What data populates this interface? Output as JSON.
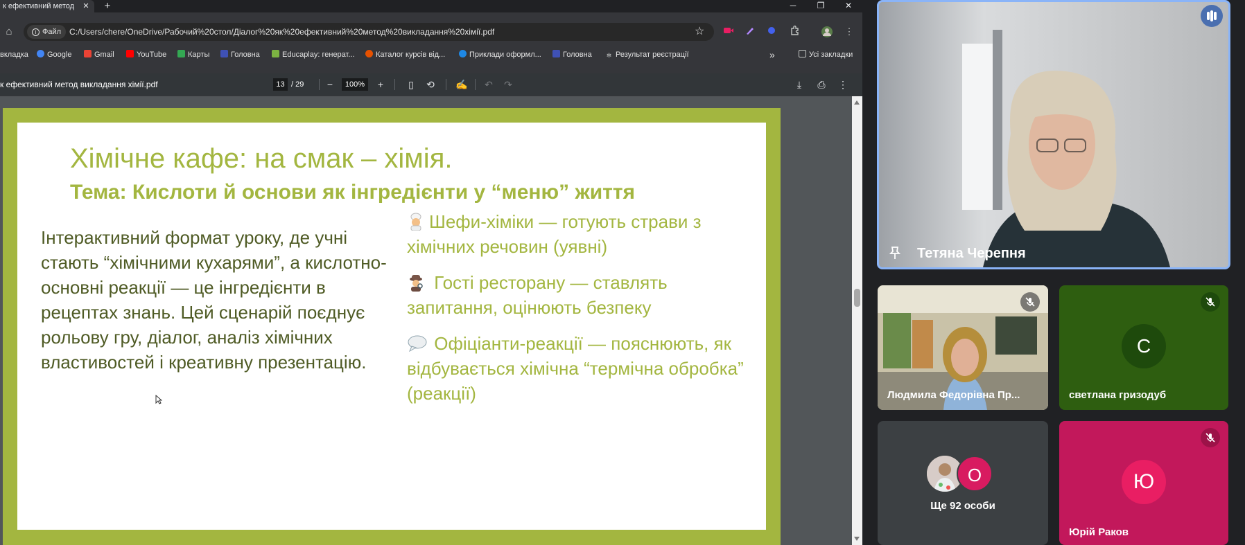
{
  "browser": {
    "tab_title": "к ефективний метод в",
    "tab_close": "✕",
    "new_tab": "+",
    "window": {
      "minimize": "─",
      "restore": "❐",
      "close": "✕"
    },
    "site_chip": "Файл",
    "url": "C:/Users/chere/OneDrive/Рабочий%20стол/Діалог%20як%20ефективний%20метод%20викладання%20хімії.pdf",
    "bookmarks": [
      {
        "label": "вкладка",
        "color": ""
      },
      {
        "label": "Google",
        "color": "#4285f4"
      },
      {
        "label": "Gmail",
        "color": "#ea4335"
      },
      {
        "label": "YouTube",
        "color": "#ff0000"
      },
      {
        "label": "Карты",
        "color": "#34a853"
      },
      {
        "label": "Головна",
        "color": "#3f51b5"
      },
      {
        "label": "Educaplay: генерат...",
        "color": "#7cb342"
      },
      {
        "label": "Каталог курсів від...",
        "color": "#e65100"
      },
      {
        "label": "Приклади оформл...",
        "color": "#1e88e5"
      },
      {
        "label": "Головна",
        "color": "#3f51b5"
      },
      {
        "label": "Результат реєстрації",
        "color": ""
      }
    ],
    "bookmarks_more": "»",
    "all_bookmarks": "Усі закладки"
  },
  "pdf": {
    "file_title": "к ефективний метод викладання хімії.pdf",
    "page": "13",
    "total_pages": "/  29",
    "zoom": "100%"
  },
  "slide": {
    "title": "Хімічне кафе: на смак – хімія.",
    "subtitle": "Тема: Кислоти й основи як інгредієнти у “меню” життя",
    "left_text": " Інтерактивний формат уроку, де учні стають “хімічними кухарями”, а кислотно-основні реакції — це інгредієнти в рецептах знань. Цей сценарій поєднує рольову гру, діалог, аналіз хімічних властивостей і креативну презентацію.",
    "right_items": [
      {
        "icon": "chef-emoji",
        "text": "Шефи-хіміки — готують страви з хімічних речовин (уявні)"
      },
      {
        "icon": "detective-emoji",
        "text": " Гості ресторану — ставлять запитання, оцінюють безпеку"
      },
      {
        "icon": "speech-bubble-emoji",
        "text": " Офіціанти-реакції — пояснюють, як відбувається хімічна “термічна обробка” (реакції)"
      }
    ],
    "colors": {
      "frame": "#a3b640",
      "title": "#a3b640",
      "body": "#4f5b25"
    }
  },
  "meet": {
    "speaker": {
      "name": "Тетяна Черепня"
    },
    "tiles": [
      {
        "name": "Людмила Федорівна Пр...",
        "muted": true
      },
      {
        "name": "светлана гризодуб",
        "initial": "С",
        "muted": true,
        "bg": "#2e5e10",
        "avatar": "#1e4a0c"
      },
      {
        "name": "Ще 92 особи",
        "initial": "О"
      },
      {
        "name": "Юрій Раков",
        "initial": "Ю",
        "muted": true,
        "bg": "#c2185b",
        "avatar": "#e91e63"
      }
    ]
  }
}
